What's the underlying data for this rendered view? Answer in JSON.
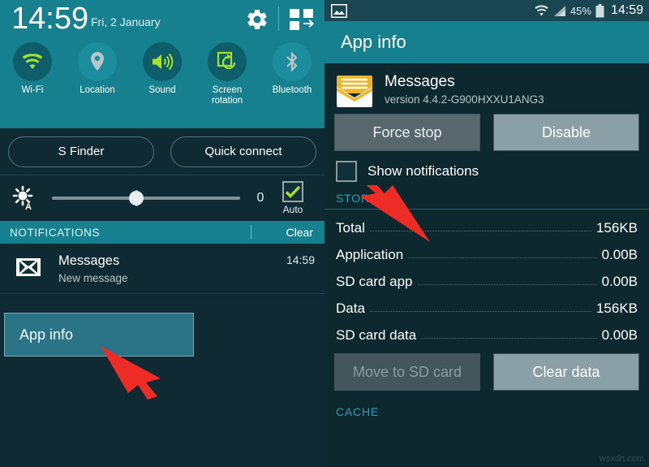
{
  "left_panel": {
    "status": {
      "time": "14:59",
      "date": "Fri, 2 January",
      "settings_icon": "gear-icon",
      "edit_icon": "quick-settings-grid-icon"
    },
    "quick_toggles": [
      {
        "label": "Wi-Fi",
        "icon": "wifi-icon",
        "state": "on"
      },
      {
        "label": "Location",
        "icon": "location-pin-icon",
        "state": "off"
      },
      {
        "label": "Sound",
        "icon": "speaker-icon",
        "state": "on"
      },
      {
        "label": "Screen\nrotation",
        "label_line1": "Screen",
        "label_line2": "rotation",
        "icon": "screen-rotation-icon",
        "state": "on"
      },
      {
        "label": "Bluetooth",
        "icon": "bluetooth-icon",
        "state": "off"
      }
    ],
    "buttons": {
      "s_finder": "S Finder",
      "quick_connect": "Quick connect"
    },
    "brightness": {
      "icon": "brightness-auto-icon",
      "value": "0",
      "auto_label": "Auto",
      "auto_checked": true,
      "slider_percent": 45
    },
    "notifications_header": {
      "title": "NOTIFICATIONS",
      "clear": "Clear"
    },
    "notification": {
      "icon": "envelope-icon",
      "title": "Messages",
      "subtitle": "New message",
      "time": "14:59"
    },
    "popup": {
      "label": "App info"
    }
  },
  "right_panel": {
    "status": {
      "left_icon": "image-notification-icon",
      "wifi_icon": "wifi-icon",
      "signal_icon": "cell-signal-icon",
      "battery_percent": "45%",
      "battery_icon": "battery-icon",
      "time": "14:59"
    },
    "actionbar": {
      "title": "App info"
    },
    "app": {
      "icon": "messages-envelope-icon",
      "name": "Messages",
      "version": "version 4.4.2-G900HXXU1ANG3"
    },
    "action_buttons": {
      "force_stop": "Force stop",
      "disable": "Disable"
    },
    "show_notifications": {
      "label": "Show notifications",
      "checked": false
    },
    "storage": {
      "section_title": "STORAGE",
      "rows": [
        {
          "key": "Total",
          "value": "156KB"
        },
        {
          "key": "Application",
          "value": "0.00B"
        },
        {
          "key": "SD card app",
          "value": "0.00B"
        },
        {
          "key": "Data",
          "value": "156KB"
        },
        {
          "key": "SD card data",
          "value": "0.00B"
        }
      ],
      "buttons": {
        "move_to_sd": "Move to SD card",
        "clear_data": "Clear data"
      }
    },
    "cache": {
      "section_title": "CACHE"
    },
    "watermark": "wsxdn.com"
  },
  "colors": {
    "accent_teal": "#17808f",
    "panel_bg": "#0f2a33",
    "toggle_on_green": "#a6e22a",
    "arrow_red": "#ee2b24",
    "section_label": "#2f9fb3"
  }
}
